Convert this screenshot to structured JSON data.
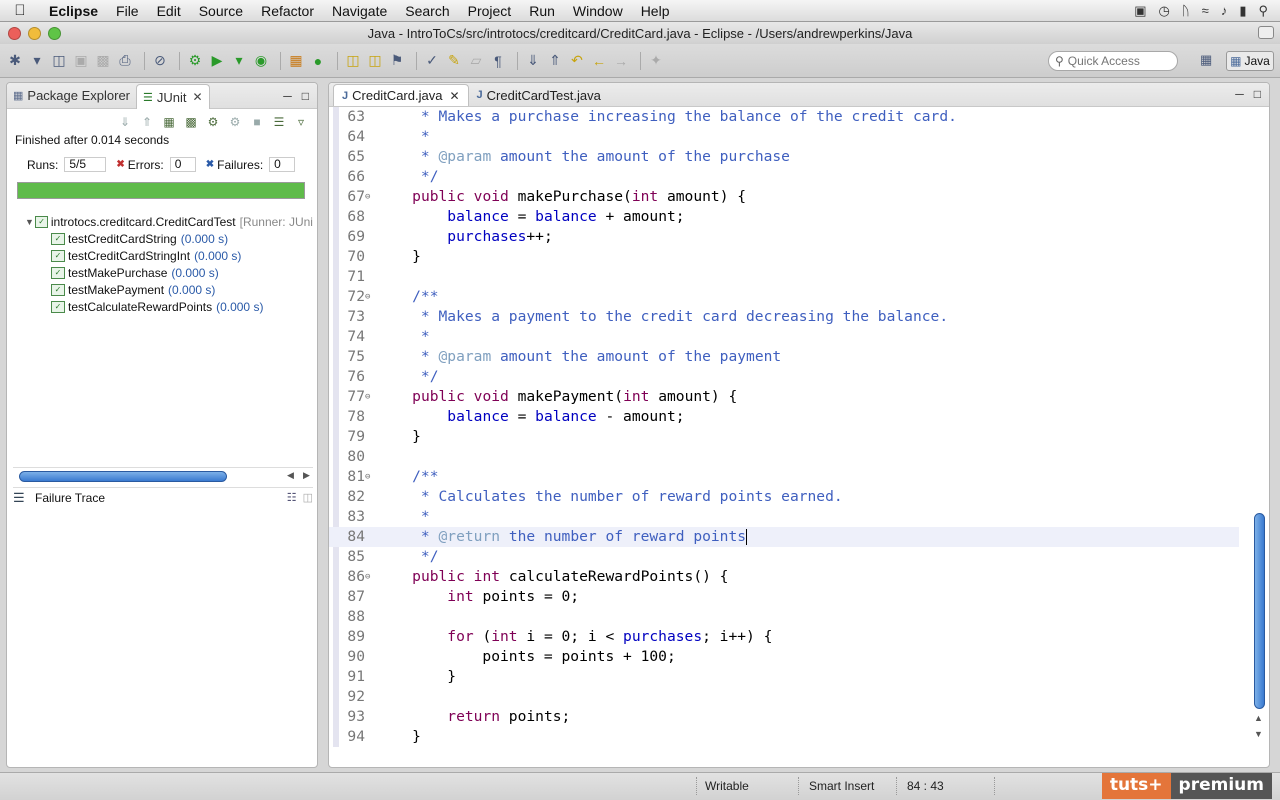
{
  "menubar": {
    "app": "Eclipse",
    "items": [
      "File",
      "Edit",
      "Source",
      "Refactor",
      "Navigate",
      "Search",
      "Project",
      "Run",
      "Window",
      "Help"
    ]
  },
  "window": {
    "title": "Java - IntroToCs/src/introtocs/creditcard/CreditCard.java - Eclipse - /Users/andrewperkins/Java"
  },
  "toolbar": {
    "quick_access_placeholder": "Quick Access",
    "perspective": "Java"
  },
  "left_panel": {
    "tabs": [
      {
        "label": "Package Explorer",
        "active": false
      },
      {
        "label": "JUnit",
        "active": true
      }
    ],
    "finished": "Finished after 0.014 seconds",
    "runs_label": "Runs:",
    "runs_value": "5/5",
    "errors_label": "Errors:",
    "errors_value": "0",
    "failures_label": "Failures:",
    "failures_value": "0",
    "progress_fraction": 1.0,
    "progress_color": "#5fbb4a",
    "suite": {
      "name": "introtocs.creditcard.CreditCardTest",
      "runner": "[Runner: JUni"
    },
    "tests": [
      {
        "name": "testCreditCardString",
        "time": "(0.000 s)"
      },
      {
        "name": "testCreditCardStringInt",
        "time": "(0.000 s)"
      },
      {
        "name": "testMakePurchase",
        "time": "(0.000 s)"
      },
      {
        "name": "testMakePayment",
        "time": "(0.000 s)"
      },
      {
        "name": "testCalculateRewardPoints",
        "time": "(0.000 s)"
      }
    ],
    "failure_trace": "Failure Trace"
  },
  "editor": {
    "tabs": [
      {
        "label": "CreditCard.java",
        "active": true
      },
      {
        "label": "CreditCardTest.java",
        "active": false
      }
    ],
    "lines": [
      {
        "n": "63",
        "fold": "",
        "current": false,
        "segs": [
          {
            "t": "     * Makes a purchase increasing the balance of the credit card.",
            "c": "cm"
          }
        ]
      },
      {
        "n": "64",
        "fold": "",
        "current": false,
        "segs": [
          {
            "t": "     *",
            "c": "cm"
          }
        ]
      },
      {
        "n": "65",
        "fold": "",
        "current": false,
        "segs": [
          {
            "t": "     * ",
            "c": "cm"
          },
          {
            "t": "@param",
            "c": "tag"
          },
          {
            "t": " amount the amount of the purchase",
            "c": "cm"
          }
        ]
      },
      {
        "n": "66",
        "fold": "",
        "current": false,
        "segs": [
          {
            "t": "     */",
            "c": "cm"
          }
        ]
      },
      {
        "n": "67",
        "fold": "⊖",
        "current": false,
        "segs": [
          {
            "t": "    ",
            "c": ""
          },
          {
            "t": "public",
            "c": "kw"
          },
          {
            "t": " ",
            "c": ""
          },
          {
            "t": "void",
            "c": "kw"
          },
          {
            "t": " makePurchase(",
            "c": ""
          },
          {
            "t": "int",
            "c": "kw"
          },
          {
            "t": " amount) {",
            "c": ""
          }
        ]
      },
      {
        "n": "68",
        "fold": "",
        "current": false,
        "segs": [
          {
            "t": "        ",
            "c": ""
          },
          {
            "t": "balance",
            "c": "fld"
          },
          {
            "t": " = ",
            "c": ""
          },
          {
            "t": "balance",
            "c": "fld"
          },
          {
            "t": " + amount;",
            "c": ""
          }
        ]
      },
      {
        "n": "69",
        "fold": "",
        "current": false,
        "segs": [
          {
            "t": "        ",
            "c": ""
          },
          {
            "t": "purchases",
            "c": "fld"
          },
          {
            "t": "++;",
            "c": ""
          }
        ]
      },
      {
        "n": "70",
        "fold": "",
        "current": false,
        "segs": [
          {
            "t": "    }",
            "c": ""
          }
        ]
      },
      {
        "n": "71",
        "fold": "",
        "current": false,
        "segs": [
          {
            "t": "",
            "c": ""
          }
        ]
      },
      {
        "n": "72",
        "fold": "⊖",
        "current": false,
        "segs": [
          {
            "t": "    /**",
            "c": "cm"
          }
        ]
      },
      {
        "n": "73",
        "fold": "",
        "current": false,
        "segs": [
          {
            "t": "     * Makes a payment to the credit card decreasing the balance.",
            "c": "cm"
          }
        ]
      },
      {
        "n": "74",
        "fold": "",
        "current": false,
        "segs": [
          {
            "t": "     *",
            "c": "cm"
          }
        ]
      },
      {
        "n": "75",
        "fold": "",
        "current": false,
        "segs": [
          {
            "t": "     * ",
            "c": "cm"
          },
          {
            "t": "@param",
            "c": "tag"
          },
          {
            "t": " amount the amount of the payment",
            "c": "cm"
          }
        ]
      },
      {
        "n": "76",
        "fold": "",
        "current": false,
        "segs": [
          {
            "t": "     */",
            "c": "cm"
          }
        ]
      },
      {
        "n": "77",
        "fold": "⊖",
        "current": false,
        "segs": [
          {
            "t": "    ",
            "c": ""
          },
          {
            "t": "public",
            "c": "kw"
          },
          {
            "t": " ",
            "c": ""
          },
          {
            "t": "void",
            "c": "kw"
          },
          {
            "t": " makePayment(",
            "c": ""
          },
          {
            "t": "int",
            "c": "kw"
          },
          {
            "t": " amount) {",
            "c": ""
          }
        ]
      },
      {
        "n": "78",
        "fold": "",
        "current": false,
        "segs": [
          {
            "t": "        ",
            "c": ""
          },
          {
            "t": "balance",
            "c": "fld"
          },
          {
            "t": " = ",
            "c": ""
          },
          {
            "t": "balance",
            "c": "fld"
          },
          {
            "t": " - amount;",
            "c": ""
          }
        ]
      },
      {
        "n": "79",
        "fold": "",
        "current": false,
        "segs": [
          {
            "t": "    }",
            "c": ""
          }
        ]
      },
      {
        "n": "80",
        "fold": "",
        "current": false,
        "segs": [
          {
            "t": "",
            "c": ""
          }
        ]
      },
      {
        "n": "81",
        "fold": "⊖",
        "current": false,
        "segs": [
          {
            "t": "    /**",
            "c": "cm"
          }
        ]
      },
      {
        "n": "82",
        "fold": "",
        "current": false,
        "segs": [
          {
            "t": "     * Calculates the number of reward points earned.",
            "c": "cm"
          }
        ]
      },
      {
        "n": "83",
        "fold": "",
        "current": false,
        "segs": [
          {
            "t": "     *",
            "c": "cm"
          }
        ]
      },
      {
        "n": "84",
        "fold": "",
        "current": true,
        "segs": [
          {
            "t": "     * ",
            "c": "cm"
          },
          {
            "t": "@return",
            "c": "tag"
          },
          {
            "t": " the number of reward points",
            "c": "cm"
          }
        ]
      },
      {
        "n": "85",
        "fold": "",
        "current": false,
        "segs": [
          {
            "t": "     */",
            "c": "cm"
          }
        ]
      },
      {
        "n": "86",
        "fold": "⊖",
        "current": false,
        "segs": [
          {
            "t": "    ",
            "c": ""
          },
          {
            "t": "public",
            "c": "kw"
          },
          {
            "t": " ",
            "c": ""
          },
          {
            "t": "int",
            "c": "kw"
          },
          {
            "t": " calculateRewardPoints() {",
            "c": ""
          }
        ]
      },
      {
        "n": "87",
        "fold": "",
        "current": false,
        "segs": [
          {
            "t": "        ",
            "c": ""
          },
          {
            "t": "int",
            "c": "kw"
          },
          {
            "t": " points = 0;",
            "c": ""
          }
        ]
      },
      {
        "n": "88",
        "fold": "",
        "current": false,
        "segs": [
          {
            "t": "",
            "c": ""
          }
        ]
      },
      {
        "n": "89",
        "fold": "",
        "current": false,
        "segs": [
          {
            "t": "        ",
            "c": ""
          },
          {
            "t": "for",
            "c": "kw"
          },
          {
            "t": " (",
            "c": ""
          },
          {
            "t": "int",
            "c": "kw"
          },
          {
            "t": " i = 0; i < ",
            "c": ""
          },
          {
            "t": "purchases",
            "c": "fld"
          },
          {
            "t": "; i++) {",
            "c": ""
          }
        ]
      },
      {
        "n": "90",
        "fold": "",
        "current": false,
        "segs": [
          {
            "t": "            points = points + 100;",
            "c": ""
          }
        ]
      },
      {
        "n": "91",
        "fold": "",
        "current": false,
        "segs": [
          {
            "t": "        }",
            "c": ""
          }
        ]
      },
      {
        "n": "92",
        "fold": "",
        "current": false,
        "segs": [
          {
            "t": "",
            "c": ""
          }
        ]
      },
      {
        "n": "93",
        "fold": "",
        "current": false,
        "segs": [
          {
            "t": "        ",
            "c": ""
          },
          {
            "t": "return",
            "c": "kw"
          },
          {
            "t": " points;",
            "c": ""
          }
        ]
      },
      {
        "n": "94",
        "fold": "",
        "current": false,
        "segs": [
          {
            "t": "    }",
            "c": ""
          }
        ]
      }
    ]
  },
  "statusbar": {
    "writable": "Writable",
    "insert_mode": "Smart Insert",
    "position": "84 : 43"
  },
  "watermark": {
    "part1": "tuts+",
    "part2": "premium"
  },
  "colors": {
    "keyword": "#7f0055",
    "comment": "#3f5fbf",
    "javadoc_tag": "#7f9fbf",
    "field": "#0000c0"
  }
}
